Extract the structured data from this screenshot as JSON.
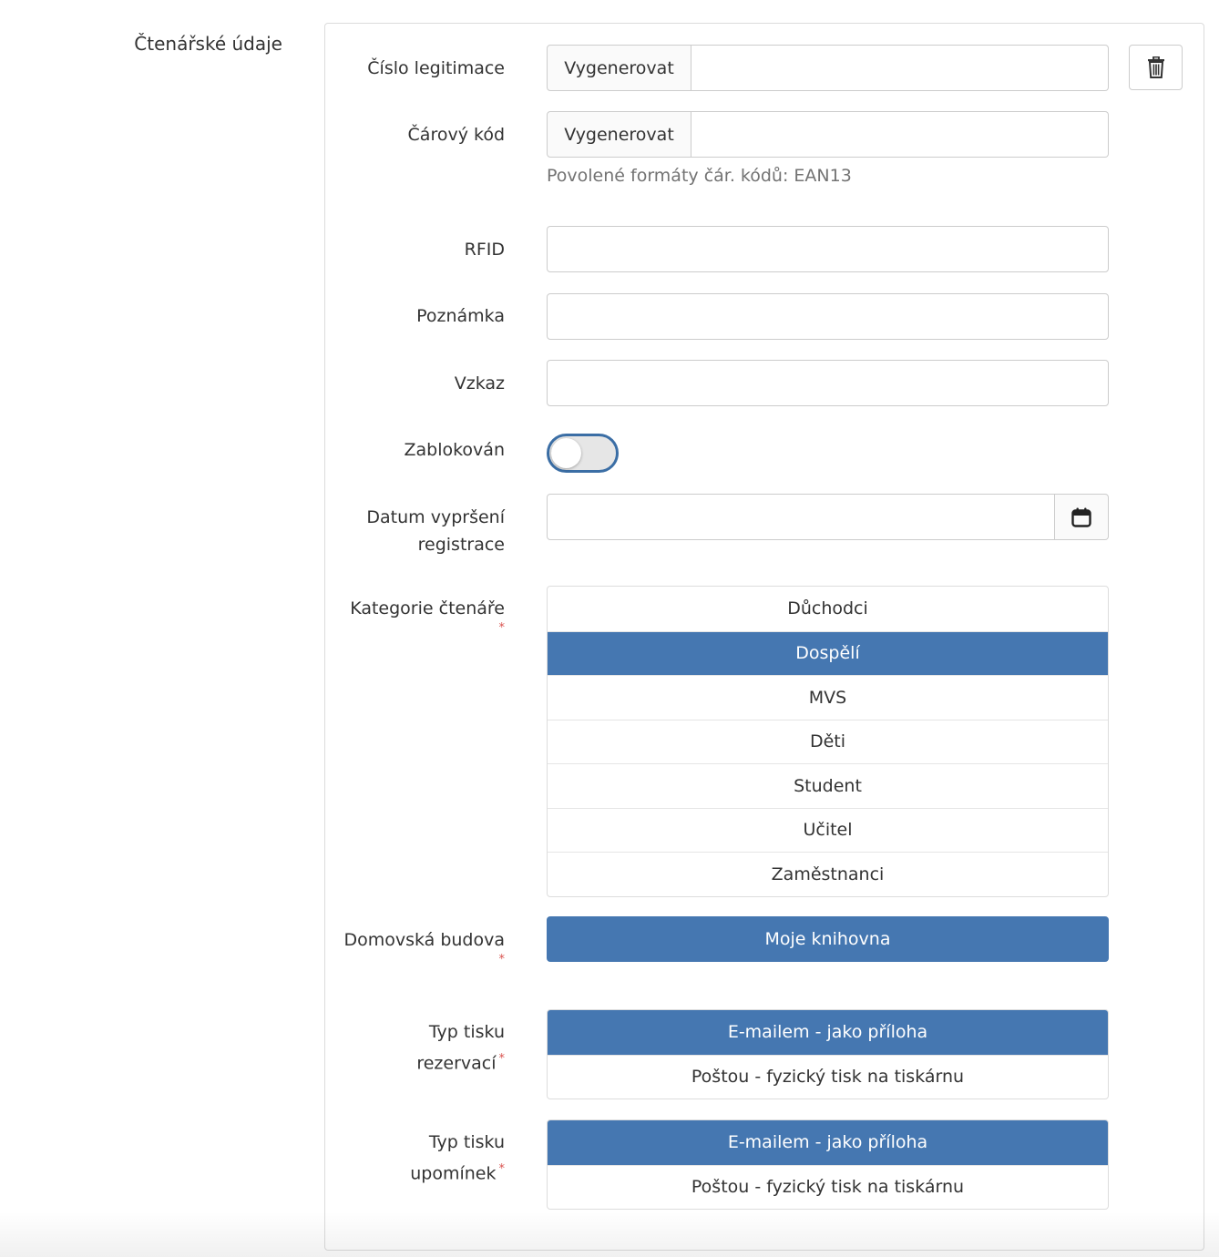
{
  "section": {
    "title": "Čtenářské údaje"
  },
  "fields": {
    "card_number": {
      "label": "Číslo legitimace",
      "button": "Vygenerovat",
      "value": ""
    },
    "barcode": {
      "label": "Čárový kód",
      "button": "Vygenerovat",
      "value": "",
      "help": "Povolené formáty čár. kódů: EAN13"
    },
    "rfid": {
      "label": "RFID",
      "value": ""
    },
    "note": {
      "label": "Poznámka",
      "value": ""
    },
    "message": {
      "label": "Vzkaz",
      "value": ""
    },
    "blocked": {
      "label": "Zablokován",
      "checked": false
    },
    "expiry": {
      "label_line1": "Datum vypršení",
      "label_line2": "registrace",
      "value": ""
    },
    "category": {
      "label": "Kategorie čtenáře",
      "required": "*",
      "options": [
        "Důchodci",
        "Dospělí",
        "MVS",
        "Děti",
        "Student",
        "Učitel",
        "Zaměstnanci"
      ],
      "selected": "Dospělí"
    },
    "home_building": {
      "label": "Domovská budova",
      "required": "*",
      "value": "Moje knihovna"
    },
    "reservation_print": {
      "label_line1": "Typ tisku",
      "label_line2": "rezervací",
      "required": "*",
      "options": [
        "E-mailem - jako příloha",
        "Poštou - fyzický tisk na tiskárnu"
      ],
      "selected": "E-mailem - jako příloha"
    },
    "reminder_print": {
      "label_line1": "Typ tisku",
      "label_line2": "upomínek",
      "required": "*",
      "options": [
        "E-mailem - jako příloha",
        "Poštou - fyzický tisk na tiskárnu"
      ],
      "selected": "E-mailem - jako příloha"
    }
  },
  "colors": {
    "accent": "#4577b1",
    "toggle_border": "#3b6ea5",
    "required": "#d9534f"
  },
  "icons": {
    "delete": "trash-icon",
    "calendar": "calendar-icon"
  }
}
